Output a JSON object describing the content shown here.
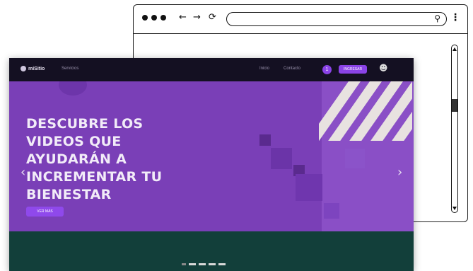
{
  "browser": {
    "back": "←",
    "forward": "→",
    "reload": "⟳",
    "search_icon": "⚲",
    "menu": "⋮",
    "url": ""
  },
  "site": {
    "logo": "miSitio",
    "nav_link": "Servicios",
    "header_links": [
      "Inicio",
      "Contacto"
    ],
    "badge": "1",
    "header_button": "INGRESAR",
    "hero": {
      "title_lines": [
        "DESCUBRE LOS",
        "VIDEOS QUE",
        "AYUDARÁN A",
        "INCREMENTAR TU",
        "BIENESTAR"
      ],
      "cta": "VER MÁS",
      "prev": "‹",
      "next": "›"
    },
    "carousel_dots": 5,
    "active_dot": 0,
    "colors": {
      "header": "#141022",
      "hero": "#7a3fb7",
      "accent": "#8a43e6",
      "band": "#123f3a"
    }
  }
}
